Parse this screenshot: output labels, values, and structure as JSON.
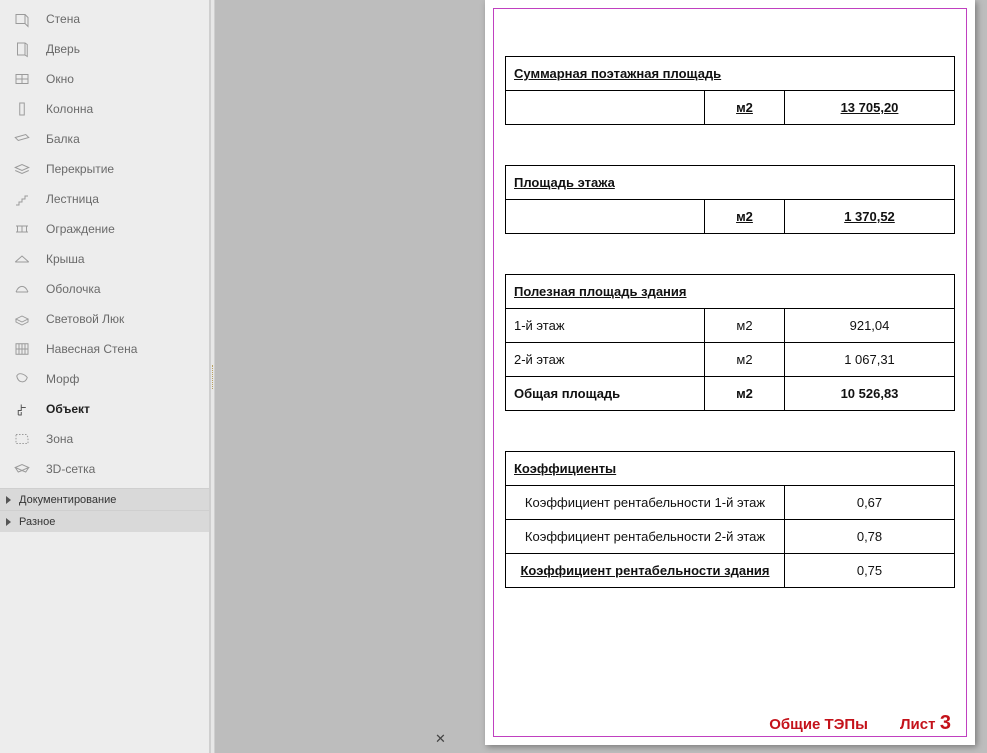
{
  "sidebar": {
    "tools": [
      {
        "id": "wall",
        "label": "Стена",
        "icon": "wall"
      },
      {
        "id": "door",
        "label": "Дверь",
        "icon": "door"
      },
      {
        "id": "window",
        "label": "Окно",
        "icon": "window"
      },
      {
        "id": "column",
        "label": "Колонна",
        "icon": "column"
      },
      {
        "id": "beam",
        "label": "Балка",
        "icon": "beam"
      },
      {
        "id": "slab",
        "label": "Перекрытие",
        "icon": "slab"
      },
      {
        "id": "stair",
        "label": "Лестница",
        "icon": "stair"
      },
      {
        "id": "railing",
        "label": "Ограждение",
        "icon": "railing"
      },
      {
        "id": "roof",
        "label": "Крыша",
        "icon": "roof"
      },
      {
        "id": "shell",
        "label": "Оболочка",
        "icon": "shell"
      },
      {
        "id": "skylight",
        "label": "Световой Люк",
        "icon": "skylight"
      },
      {
        "id": "curtainwall",
        "label": "Навесная Стена",
        "icon": "curtainwall"
      },
      {
        "id": "morph",
        "label": "Морф",
        "icon": "morph"
      },
      {
        "id": "object",
        "label": "Объект",
        "icon": "object",
        "selected": true
      },
      {
        "id": "zone",
        "label": "Зона",
        "icon": "zone"
      },
      {
        "id": "mesh",
        "label": "3D-сетка",
        "icon": "mesh"
      }
    ],
    "sections": [
      {
        "id": "documenting",
        "label": "Документирование"
      },
      {
        "id": "misc",
        "label": "Разное"
      }
    ]
  },
  "sheet": {
    "block1": {
      "title": "Суммарная поэтажная площадь",
      "unit": "м2",
      "value": "13 705,20"
    },
    "block2": {
      "title": "Площадь этажа",
      "unit": "м2",
      "value": "1 370,52"
    },
    "block3": {
      "title": "Полезная площадь здания",
      "rows": [
        {
          "label": "1-й этаж",
          "unit": "м2",
          "value": "921,04"
        },
        {
          "label": "2-й этаж",
          "unit": "м2",
          "value": "1 067,31"
        },
        {
          "label": "Общая площадь",
          "unit": "м2",
          "value": "10 526,83",
          "bold": true
        }
      ]
    },
    "block4": {
      "title": "Коэффициенты",
      "rows": [
        {
          "label": "Коэффициент рентабельности 1-й этаж",
          "value": "0,67"
        },
        {
          "label": "Коэффициент рентабельности 2-й этаж",
          "value": "0,78"
        },
        {
          "label": "Коэффициент рентабельности здания",
          "value": "0,75",
          "bold": true
        }
      ]
    },
    "footer": {
      "title": "Общие ТЭПы",
      "page_word": "Лист",
      "page_num": "3"
    }
  }
}
